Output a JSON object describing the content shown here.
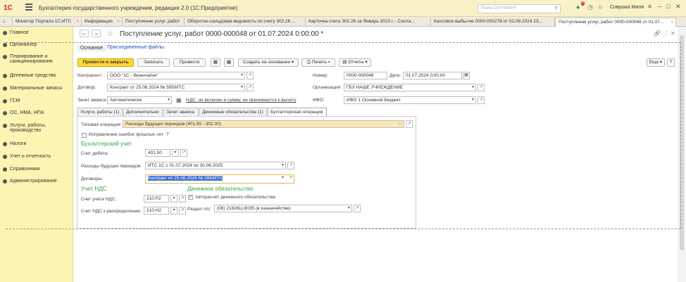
{
  "titlebar": {
    "logo": "1С",
    "app_title": "Бухгалтерия государственного учреждения, редакция 2.0  (1С:Предприятие)",
    "search_placeholder": "Поиск Ctrl+Shift+F",
    "user": "Совушка Миля",
    "notification_count": "4"
  },
  "tabs": [
    {
      "label": "Монитор Портала 1С:ИТС"
    },
    {
      "label": "Информация"
    },
    {
      "label": "Поступление услуг, работ"
    },
    {
      "label": "Оборотно-сальдовая ведомость по счету 302.26 ..."
    },
    {
      "label": "Карточка счета 302.26 за Январь 2023 г. - Сента..."
    },
    {
      "label": "Кассовое выбытие 0000-000278 от 02.08.2024 23..."
    },
    {
      "label": "Поступление услуг, работ 0000-000048 от 01.07..."
    }
  ],
  "sidebar": {
    "items": [
      {
        "label": "Главное"
      },
      {
        "label": "Органайзер"
      },
      {
        "label": "Планирование и санкционирование"
      },
      {
        "label": "Денежные средства"
      },
      {
        "label": "Материальные запасы"
      },
      {
        "label": "ГСМ"
      },
      {
        "label": "ОС, НМА, НПА"
      },
      {
        "label": "Услуги, работы, производство"
      },
      {
        "label": "Налоги"
      },
      {
        "label": "Учет и отчетность"
      },
      {
        "label": "Справочники"
      },
      {
        "label": "Администрирование"
      }
    ]
  },
  "document": {
    "title": "Поступление услуг, работ 0000-000048 от 01.07.2024 0:00:00 *",
    "subtabs": {
      "main": "Основное",
      "files": "Присоединенные файлы"
    },
    "toolbar": {
      "post_close": "Провести и закрыть",
      "save": "Записать",
      "post": "Провести",
      "create_based": "Создать на основании",
      "print": "Печать",
      "reports": "Отчеты",
      "more": "Еще",
      "help": "?"
    },
    "fields": {
      "contractor_label": "Контрагент:",
      "contractor_value": "ООО \"1С - Франчайзи\"",
      "contract_label": "Договор:",
      "contract_value": "Контракт от 25.06.2024 № 595/ИТС",
      "advance_label": "Зачет аванса:",
      "advance_value": "Автоматически",
      "vat_link": "НДС: не включен в сумму, не принимается к вычету",
      "number_label": "Номер:",
      "number_value": "0000-000048",
      "date_label": "Дата:",
      "date_value": "01.07.2024  0:00:00",
      "org_label": "Организация:",
      "org_value": "ГБУ НАШЕ УЧРЕЖДЕНИЕ",
      "ifo_label": "ИФО:",
      "ifo_value": "ИФО 1 Основной Бюджет"
    },
    "form_tabs": [
      {
        "label": "Услуги, работы (1)"
      },
      {
        "label": "Дополнительно"
      },
      {
        "label": "Зачет аванса"
      },
      {
        "label": "Денежные обязательства (1)"
      },
      {
        "label": "Бухгалтерская операция"
      }
    ],
    "accounting": {
      "typical_op_label": "Типовая операция:",
      "typical_op_value": "Расходы будущих периодов (401.50 - 302.00)",
      "fix_errors_label": "Исправление ошибок прошлых лет",
      "fix_errors_help": "?",
      "section_title": "Бухгалтерский учет",
      "debit_label": "Счет дебета:",
      "debit_value": "401.50",
      "future_exp_label": "Расходы будущих периодов:",
      "future_exp_value": "ИТС 1С с 01.07.2024 по 30.06.2025",
      "contracts_label": "Договоры:",
      "contracts_value": "Контракт от 25.06.2024 № 595/ИТС",
      "vat_section": "Учет НДС",
      "vat_account_label": "Счет учета НДС:",
      "vat_account_value": "210.Р2",
      "vat_dist_label": "Счет НДС к распределению:",
      "vat_dist_value": "210.Н2",
      "money_section": "Денежное обязательство",
      "autocalc_label": "Авторасчет денежного обязательства",
      "section_ls_label": "Раздел л/с:",
      "section_ls_value": "(06) 21826LL6035 (в казначействе)"
    }
  }
}
